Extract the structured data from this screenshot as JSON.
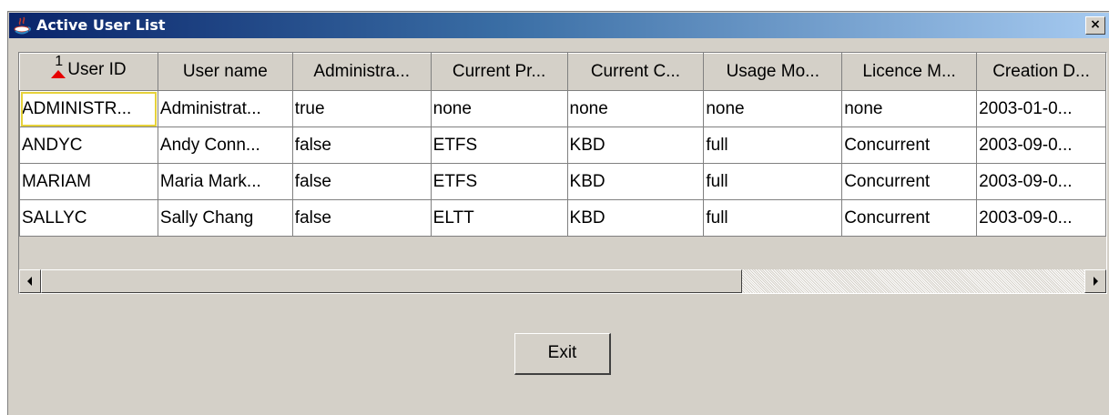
{
  "window": {
    "title": "Active User List",
    "close_label": "×",
    "title_icon": "java-cup-icon"
  },
  "table": {
    "columns": [
      {
        "label": "User ID",
        "sort_order": "1",
        "sort_direction": "ascending"
      },
      {
        "label": "User name"
      },
      {
        "label": "Administra..."
      },
      {
        "label": "Current Pr..."
      },
      {
        "label": "Current C..."
      },
      {
        "label": "Usage Mo..."
      },
      {
        "label": "Licence M..."
      },
      {
        "label": "Creation D..."
      }
    ],
    "rows": [
      [
        "ADMINISTR...",
        "Administrat...",
        "true",
        "none",
        "none",
        "none",
        "none",
        "2003-01-0..."
      ],
      [
        "ANDYC",
        "Andy Conn...",
        "false",
        "ETFS",
        "KBD",
        "full",
        "Concurrent",
        "2003-09-0..."
      ],
      [
        "MARIAM",
        "Maria Mark...",
        "false",
        "ETFS",
        "KBD",
        "full",
        "Concurrent",
        "2003-09-0..."
      ],
      [
        "SALLYC",
        "Sally Chang",
        "false",
        "ELTT",
        "KBD",
        "full",
        "Concurrent",
        "2003-09-0..."
      ]
    ]
  },
  "scrollbar": {
    "left_icon": "arrow-left-icon",
    "right_icon": "arrow-right-icon",
    "position": 0.0
  },
  "buttons": {
    "exit_label": "Exit"
  },
  "colors": {
    "titlebar_start": "#0a246a",
    "titlebar_end": "#a6caf0",
    "window_bg": "#d4d0c8",
    "sort_arrow": "#e60000"
  }
}
